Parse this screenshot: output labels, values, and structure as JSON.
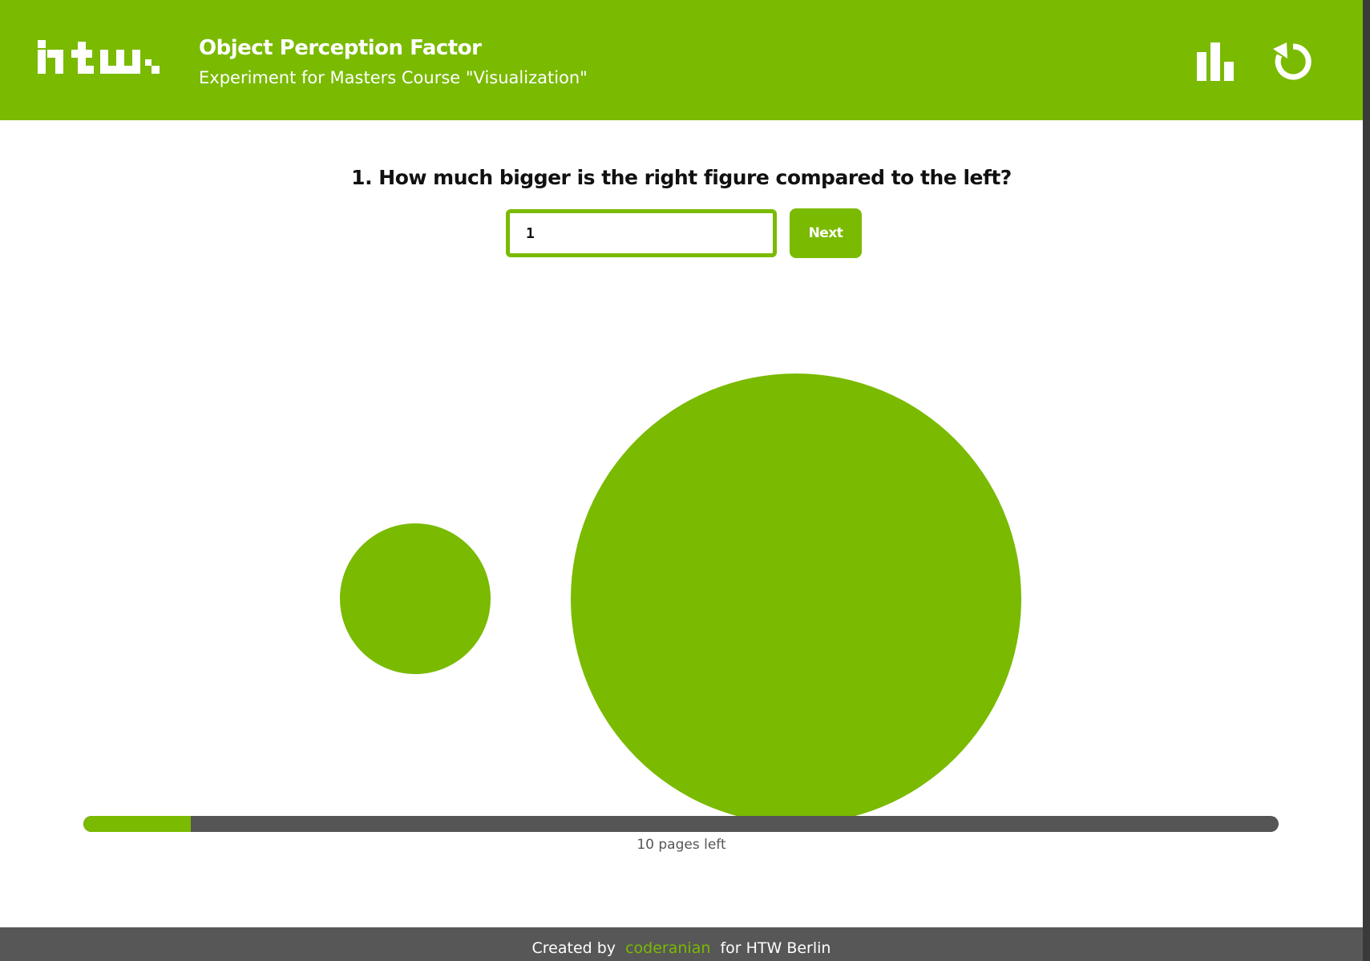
{
  "header": {
    "logo": "htw.",
    "title": "Object Perception Factor",
    "subtitle": "Experiment for Masters Course \"Visualization\"",
    "stats_icon": "bar-chart-icon",
    "restart_icon": "restart-icon"
  },
  "question": {
    "text": "1. How much bigger is the right figure compared to the left?"
  },
  "answer": {
    "value": "1"
  },
  "next_button": {
    "label": "Next"
  },
  "figures": {
    "shape": "circle",
    "color": "#7aba00"
  },
  "progress": {
    "completed_fraction": 0.09,
    "pages_left_text": "10 pages left"
  },
  "footer": {
    "created_by": "Created by",
    "author": "coderanian",
    "for_text": "for HTW Berlin"
  },
  "colors": {
    "accent": "#7aba00",
    "track": "#555555",
    "footer": "#575757"
  }
}
